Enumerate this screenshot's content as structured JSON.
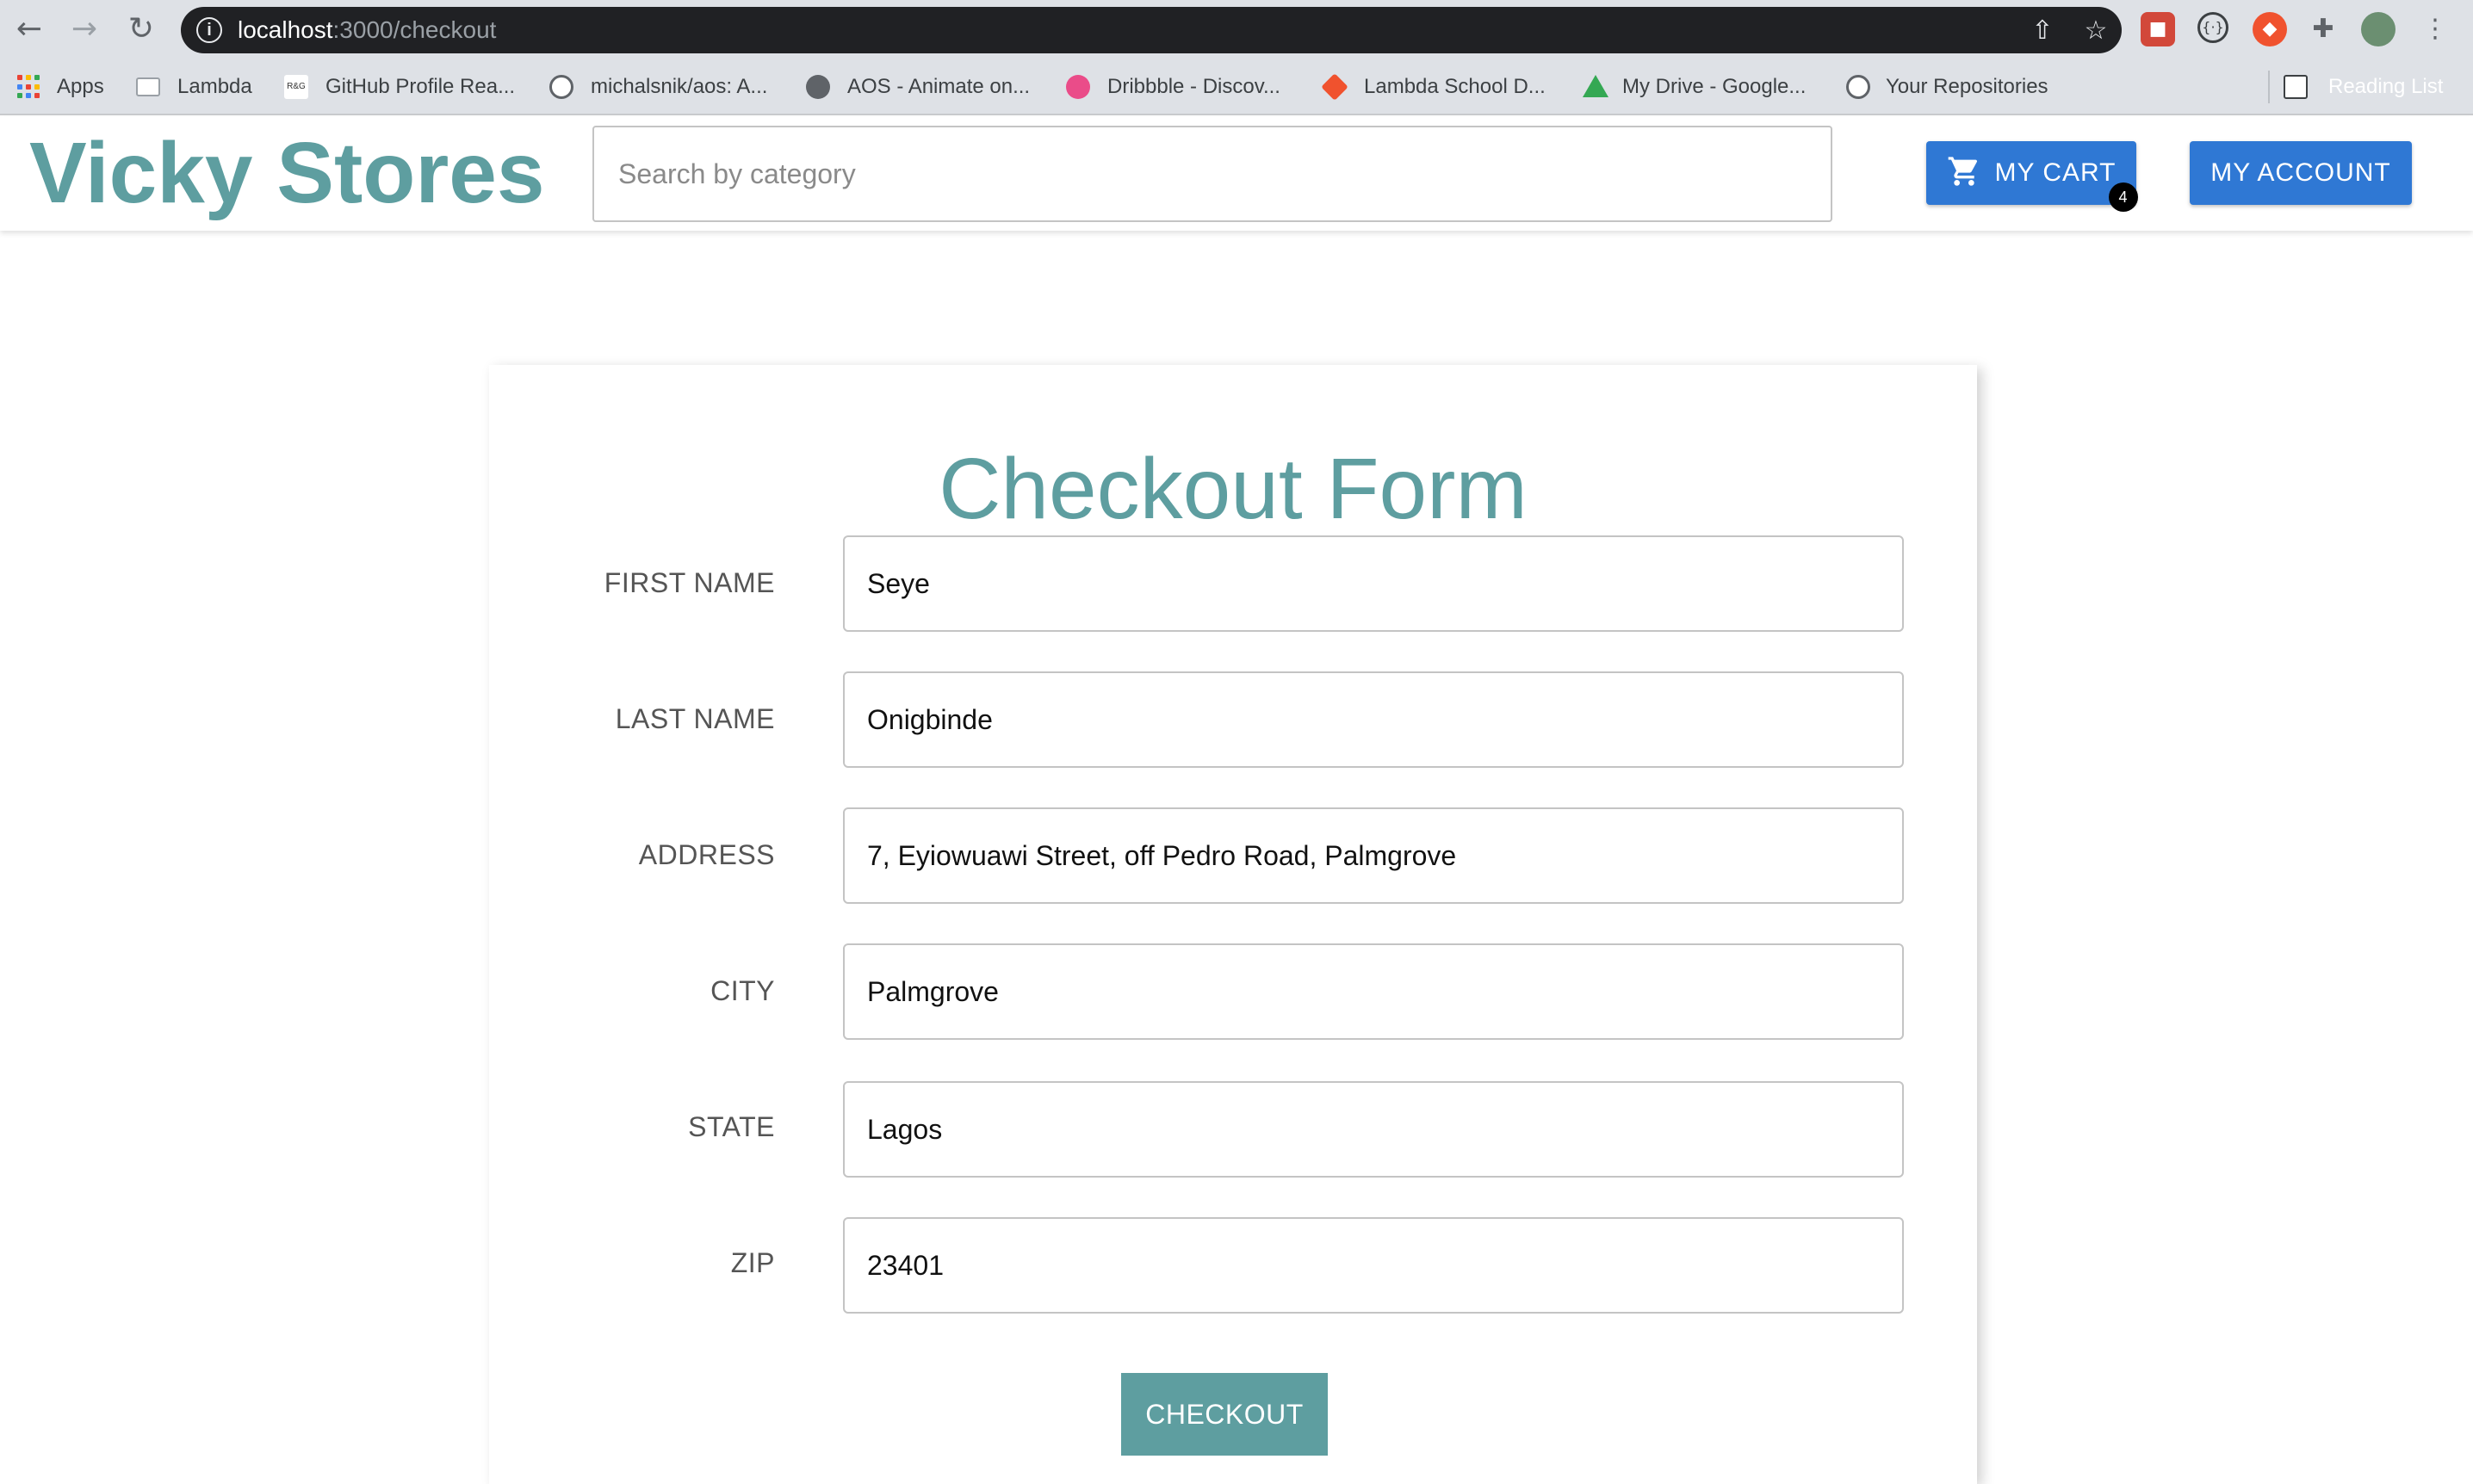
{
  "browser": {
    "url_host": "localhost",
    "url_path": ":3000/checkout",
    "bookmarks": [
      {
        "label": "Apps",
        "icon": "apps-grid-icon"
      },
      {
        "label": "Lambda",
        "icon": "folder-icon"
      },
      {
        "label": "GitHub Profile Rea...",
        "icon": "readme-icon"
      },
      {
        "label": "michalsnik/aos: A...",
        "icon": "github-icon"
      },
      {
        "label": "AOS - Animate on...",
        "icon": "globe-icon"
      },
      {
        "label": "Dribbble - Discov...",
        "icon": "dribbble-icon"
      },
      {
        "label": "Lambda School D...",
        "icon": "lambda-icon"
      },
      {
        "label": "My Drive - Google...",
        "icon": "google-drive-icon"
      },
      {
        "label": "Your Repositories",
        "icon": "github-icon"
      }
    ],
    "reading_list": "Reading List"
  },
  "header": {
    "brand": "Vicky Stores",
    "search_placeholder": "Search by category",
    "cart_label": "MY CART",
    "cart_count": "4",
    "account_label": "MY ACCOUNT"
  },
  "form": {
    "title": "Checkout Form",
    "fields": [
      {
        "label": "FIRST NAME",
        "value": "Seye"
      },
      {
        "label": "LAST NAME",
        "value": "Onigbinde"
      },
      {
        "label": "ADDRESS",
        "value": "7, Eyiowuawi Street, off Pedro Road, Palmgrove"
      },
      {
        "label": "CITY",
        "value": "Palmgrove"
      },
      {
        "label": "STATE",
        "value": "Lagos"
      },
      {
        "label": "ZIP",
        "value": "23401"
      }
    ],
    "submit_label": "CHECKOUT"
  },
  "colors": {
    "brand": "#5e9ea0",
    "primary_button": "#2f78d4",
    "browser_chrome": "#dee1e6",
    "omnibox": "#202124"
  }
}
